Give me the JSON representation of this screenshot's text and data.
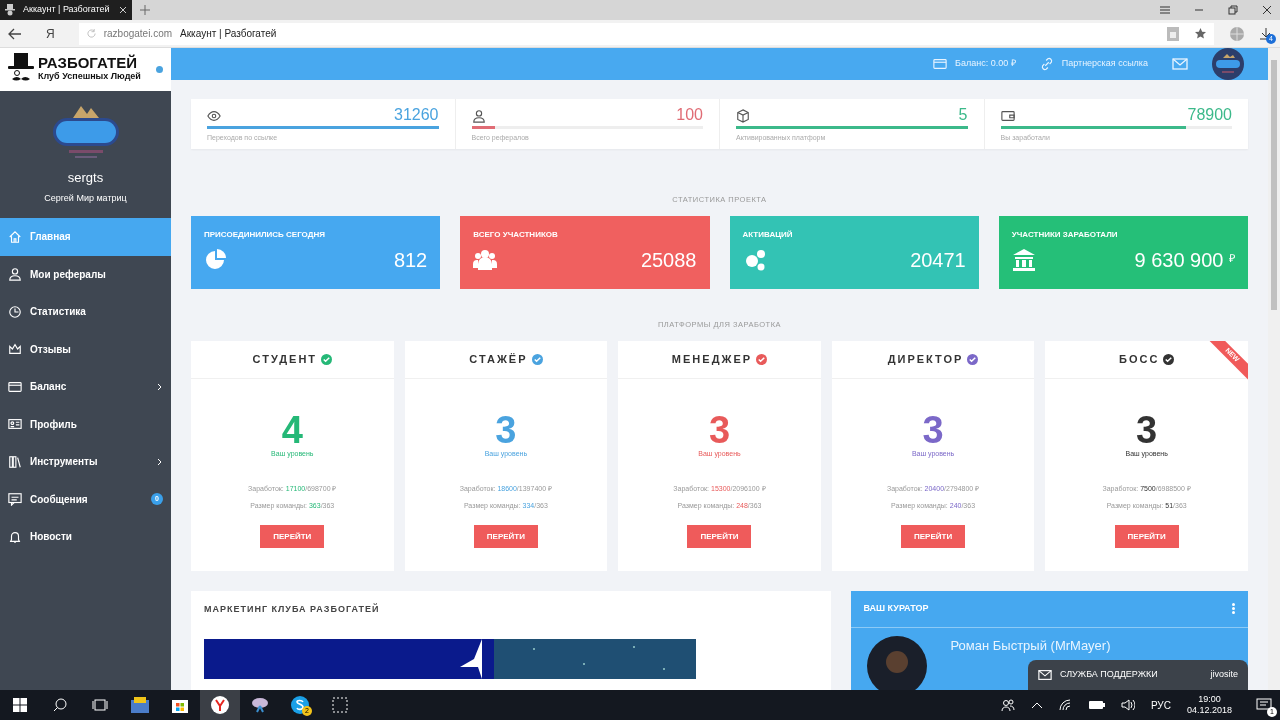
{
  "browser": {
    "tab_title": "Аккаунт | Разбогатей",
    "yandex_button": "Я",
    "url": "razbogatei.com",
    "page_title": "Аккаунт | Разбогатей",
    "download_count": "4"
  },
  "brand": {
    "title": "РАЗБОГАТЕЙ",
    "subtitle": "Клуб Успешных Людей"
  },
  "user": {
    "login": "sergts",
    "name": "Сергей Мир матриц"
  },
  "menu": [
    {
      "label": "Главная",
      "selected": true
    },
    {
      "label": "Мои рефералы",
      "selected": false
    },
    {
      "label": "Статистика",
      "selected": false
    },
    {
      "label": "Отзывы",
      "selected": false
    },
    {
      "label": "Баланс",
      "selected": false,
      "expandable": true
    },
    {
      "label": "Профиль",
      "selected": false
    },
    {
      "label": "Инструменты",
      "selected": false,
      "expandable": true
    },
    {
      "label": "Сообщения",
      "selected": false,
      "badge": "0"
    },
    {
      "label": "Новости",
      "selected": false
    }
  ],
  "header": {
    "balance": "Баланс: 0.00 ₽",
    "partner_link": "Партнерская ссылка"
  },
  "counters": [
    {
      "value": "31260",
      "label": "Переходов по ссылке",
      "level": 1.0,
      "color": "#4aa3df"
    },
    {
      "value": "100",
      "label": "Всего рефералов",
      "level": 0.1,
      "color": "#e06c75"
    },
    {
      "value": "5",
      "label": "Активированных платформ",
      "level": 1.0,
      "color": "#3cb98a"
    },
    {
      "value": "78900",
      "label": "Вы заработали",
      "level": 0.8,
      "color": "#3cb98a"
    }
  ],
  "project_stats": {
    "title": "СТАТИСТИКА ПРОЕКТА",
    "tiles": [
      {
        "label": "ПРИСОЕДИНИЛИСЬ СЕГОДНЯ",
        "value": "812",
        "color": "#46a8f0"
      },
      {
        "label": "ВСЕГО УЧАСТНИКОВ",
        "value": "25088",
        "color": "#f0605f"
      },
      {
        "label": "АКТИВАЦИЙ",
        "value": "20471",
        "color": "#33c3b4"
      },
      {
        "label": "УЧАСТНИКИ ЗАРАБОТАЛИ",
        "value": "9 630 900 $^{₽}$",
        "color": "#25bf78"
      }
    ]
  },
  "platforms": {
    "title": "ПЛАТФОРМЫ ДЛЯ ЗАРАБОТКА",
    "cards": [
      {
        "name": "СТУДЕНТ",
        "color": "#25b877",
        "rank": "4",
        "rank_label": "Ваш уровень",
        "earned_label": "Заработок:",
        "earned": "17100",
        "earned_total": "/698700 ₽",
        "team_label": "Размер команды:",
        "team": "363",
        "team_total": "/363",
        "button": "ПЕРЕЙТИ"
      },
      {
        "name": "СТАЖЁР",
        "color": "#4aa3df",
        "rank": "3",
        "rank_label": "Ваш уровень",
        "earned_label": "Заработок:",
        "earned": "18600",
        "earned_total": "/1397400 ₽",
        "team_label": "Размер команды:",
        "team": "334",
        "team_total": "/363",
        "button": "ПЕРЕЙТИ"
      },
      {
        "name": "МЕНЕДЖЕР",
        "color": "#e85a5a",
        "rank": "3",
        "rank_label": "Ваш уровень",
        "earned_label": "Заработок:",
        "earned": "15300",
        "earned_total": "/2096100 ₽",
        "team_label": "Размер команды:",
        "team": "248",
        "team_total": "/363",
        "button": "ПЕРЕЙТИ"
      },
      {
        "name": "ДИРЕКТОР",
        "color": "#7b68c8",
        "rank": "3",
        "rank_label": "Ваш уровень",
        "earned_label": "Заработок:",
        "earned": "20400",
        "earned_total": "/2794800 ₽",
        "team_label": "Размер команды:",
        "team": "240",
        "team_total": "/363",
        "button": "ПЕРЕЙТИ"
      },
      {
        "name": "БОСС",
        "color": "#333333",
        "rank": "3",
        "rank_label": "Ваш уровень",
        "earned_label": "Заработок:",
        "earned": "7500",
        "earned_total": "/6988500 ₽",
        "team_label": "Размер команды:",
        "team": "51",
        "team_total": "/363",
        "button": "ПЕРЕЙТИ",
        "ribbon": "NEW"
      }
    ]
  },
  "marketing": {
    "title": "МАРКЕТИНГ КЛУБА РАЗБОГАТЕЙ"
  },
  "curator": {
    "title": "ВАШ КУРАТОР",
    "name": "Роман Быстрый (MrMayer)"
  },
  "support_widget": {
    "label": "СЛУЖБА ПОДДЕРЖКИ",
    "brand": "jivosite"
  },
  "taskbar": {
    "skype_badge": "2",
    "language": "РУС",
    "time": "19:00",
    "date": "04.12.2018",
    "notifications": "1"
  }
}
